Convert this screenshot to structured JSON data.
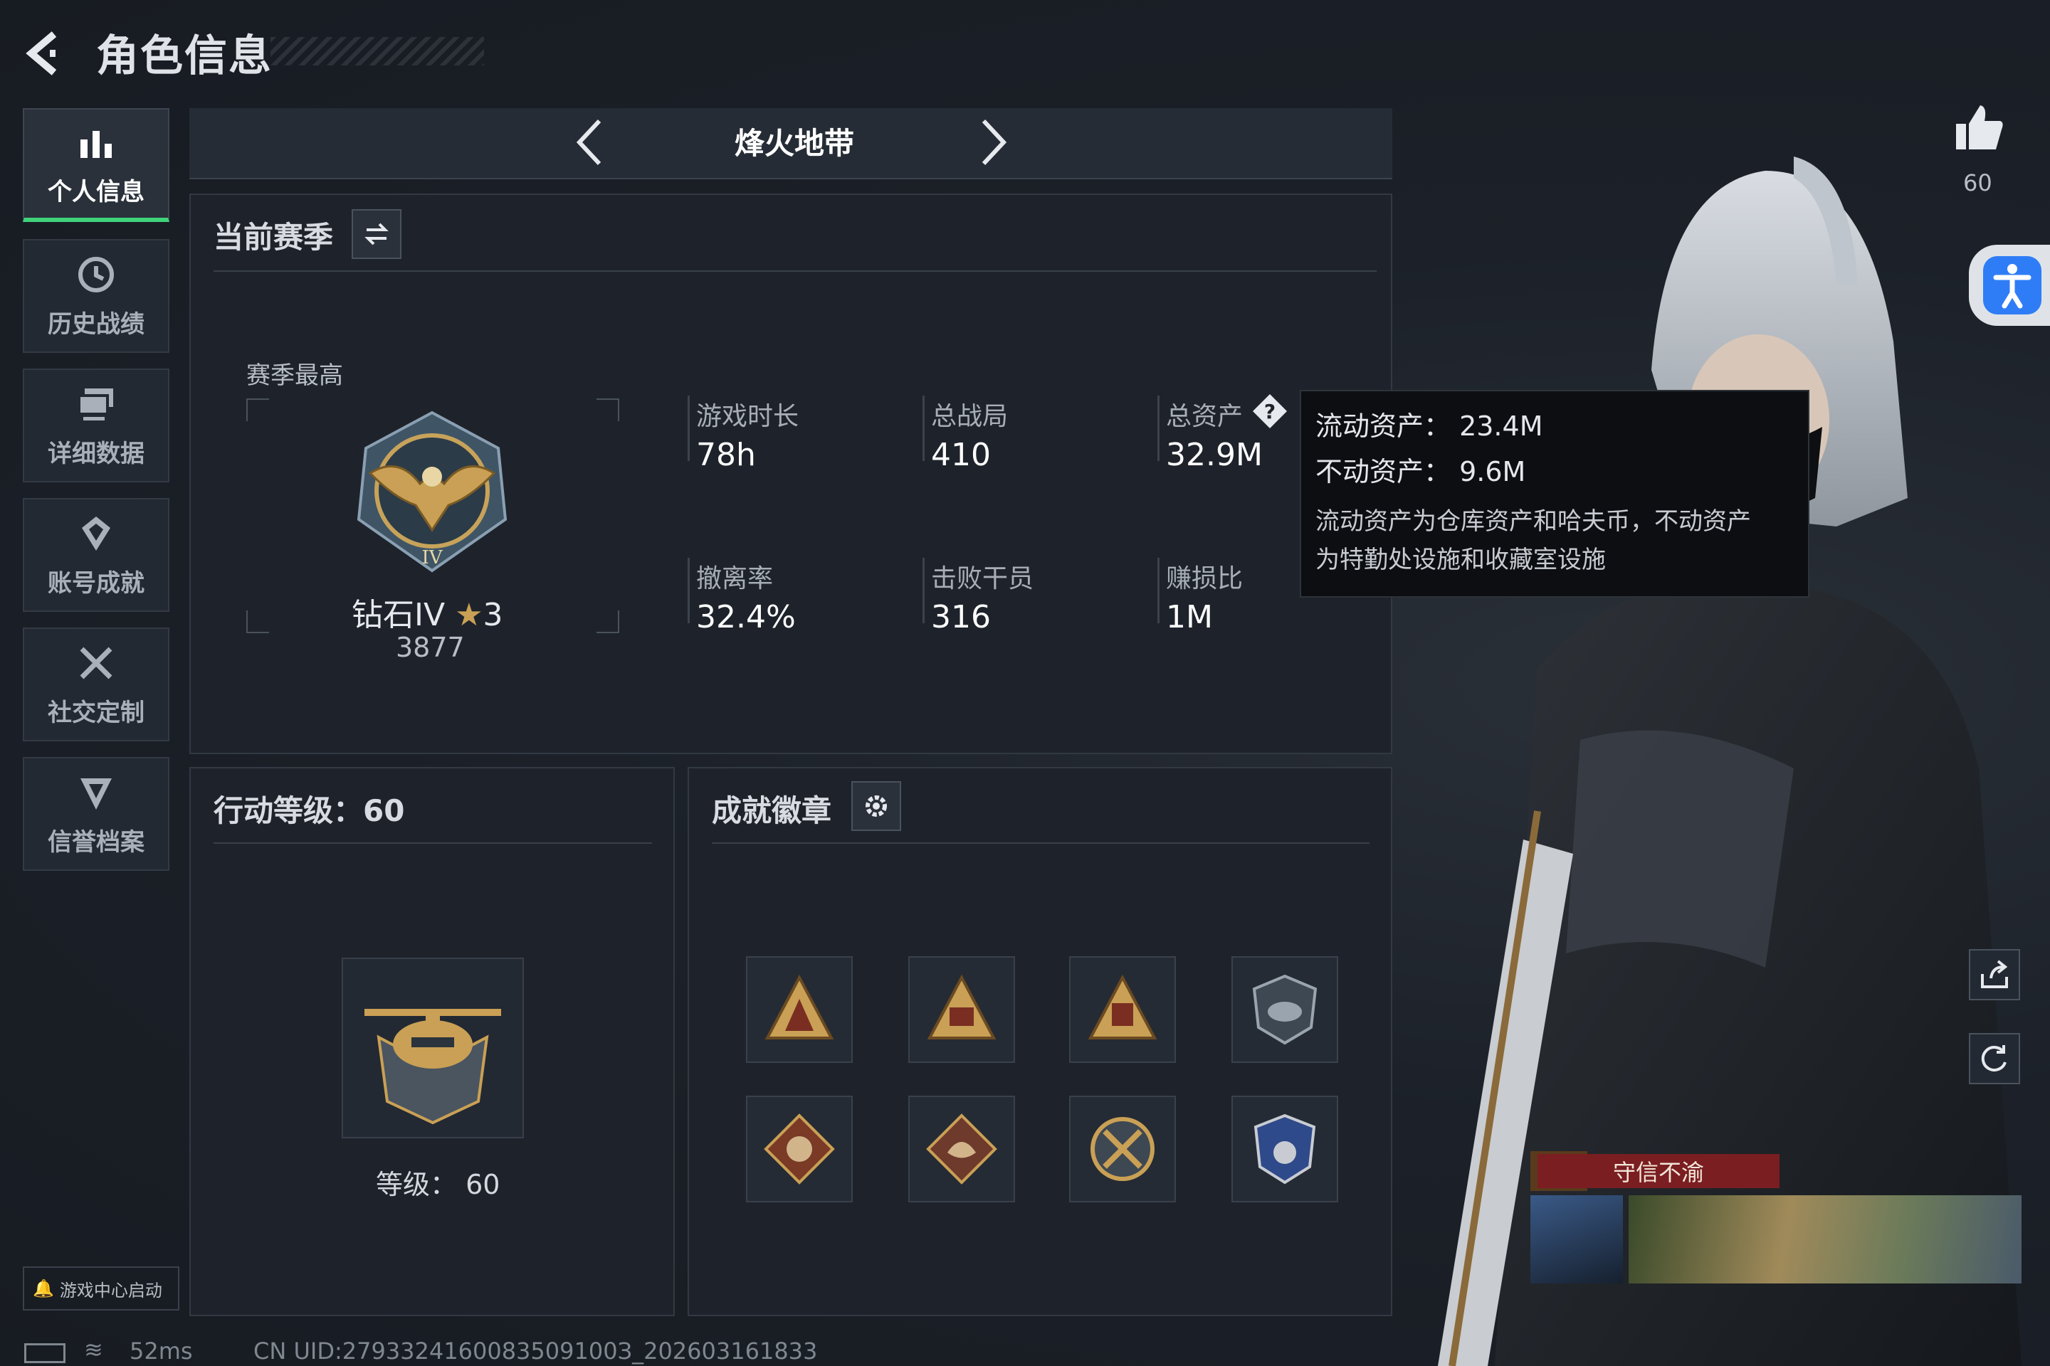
{
  "header": {
    "title": "角色信息"
  },
  "sidebar": {
    "items": [
      {
        "label": "个人信息",
        "icon": "bar-chart-icon",
        "active": true
      },
      {
        "label": "历史战绩",
        "icon": "clock-history-icon",
        "active": false
      },
      {
        "label": "详细数据",
        "icon": "monitor-stack-icon",
        "active": false
      },
      {
        "label": "账号成就",
        "icon": "achievement-emblem-icon",
        "active": false
      },
      {
        "label": "社交定制",
        "icon": "tools-cross-icon",
        "active": false
      },
      {
        "label": "信誉档案",
        "icon": "credit-shield-icon",
        "active": false
      }
    ],
    "game_center": "游戏中心启动"
  },
  "mode_nav": {
    "title": "烽火地带"
  },
  "season_panel": {
    "title": "当前赛季",
    "best_label": "赛季最高",
    "rank_name": "钻石IV",
    "rank_stars": "3",
    "rank_score": "3877",
    "stats": [
      {
        "label": "游戏时长",
        "value": "78h"
      },
      {
        "label": "总战局",
        "value": "410"
      },
      {
        "label": "总资产",
        "value": "32.9M"
      },
      {
        "label": "撤离率",
        "value": "32.4%"
      },
      {
        "label": "击败干员",
        "value": "316"
      },
      {
        "label": "赚损比",
        "value": "1M"
      }
    ]
  },
  "tooltip": {
    "liquid": "流动资产：  23.4M",
    "fixed": "不动资产：  9.6M",
    "desc_line1": "流动资产为仓库资产和哈夫币，不动资产",
    "desc_line2": "为特勤处设施和收藏室设施"
  },
  "level_panel": {
    "title": "行动等级：60",
    "level_text": "等级：  60"
  },
  "badges_panel": {
    "title": "成就徽章",
    "badges": [
      "triangle-soldiers-badge",
      "triangle-sb-badge",
      "triangle-57-badge",
      "helicopter-shield-badge",
      "wolf-diamond-badge",
      "dragon-diamond-badge",
      "crossed-target-badge",
      "police-star-badge"
    ]
  },
  "right_panel": {
    "likes": "60",
    "title_banner": "守信不渝"
  },
  "status_bar": {
    "ping": "52ms",
    "uid": "CN UID:2793324160083509100З_202603161833"
  },
  "colors": {
    "accent_green": "#3fd37a",
    "banner_red": "#7a1e22",
    "accessibility_blue": "#2f7df6"
  }
}
